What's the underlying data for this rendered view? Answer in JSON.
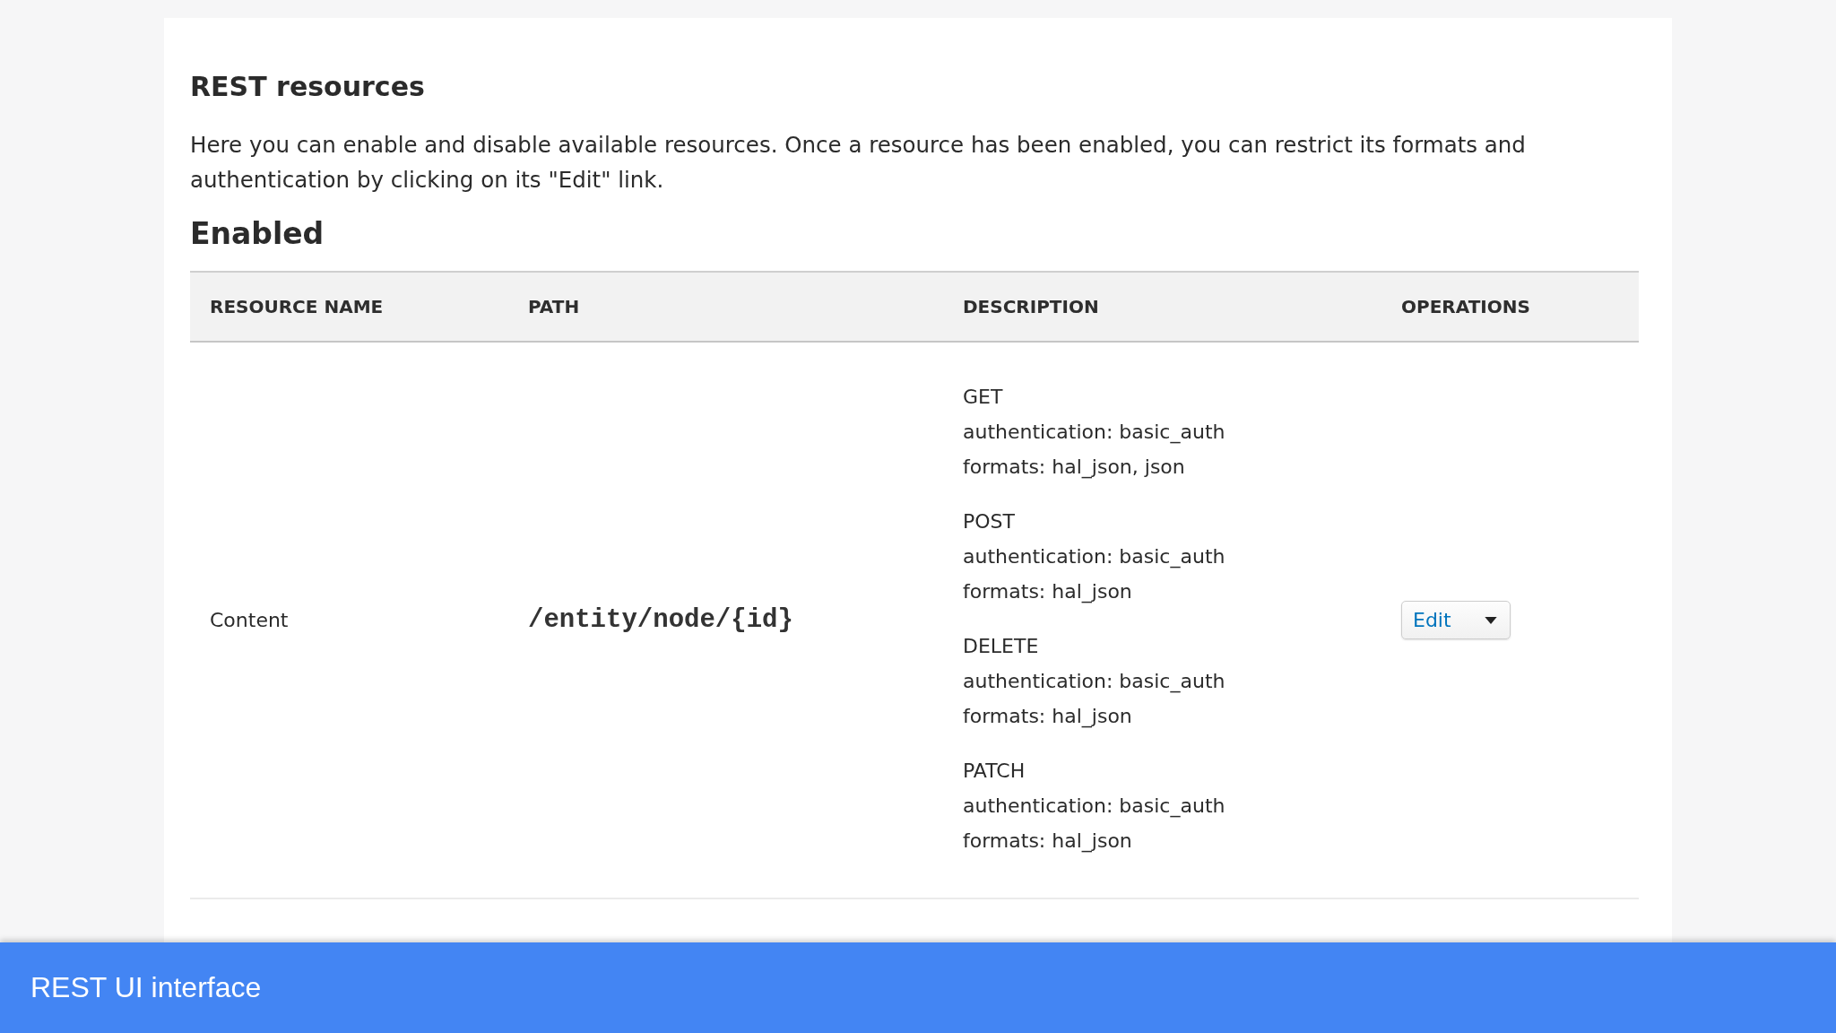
{
  "page": {
    "title": "REST resources",
    "description": "Here you can enable and disable available resources. Once a resource has been enabled, you can restrict its formats and authentication by clicking on its \"Edit\" link.",
    "section_heading": "Enabled"
  },
  "table": {
    "columns": [
      "RESOURCE NAME",
      "PATH",
      "DESCRIPTION",
      "OPERATIONS"
    ],
    "rows": [
      {
        "resource_name": "Content",
        "path": "/entity/node/{id}",
        "methods": [
          {
            "method": "GET",
            "authentication": "authentication: basic_auth",
            "formats": "formats: hal_json, json"
          },
          {
            "method": "POST",
            "authentication": "authentication: basic_auth",
            "formats": "formats: hal_json"
          },
          {
            "method": "DELETE",
            "authentication": "authentication: basic_auth",
            "formats": "formats: hal_json"
          },
          {
            "method": "PATCH",
            "authentication": "authentication: basic_auth",
            "formats": "formats: hal_json"
          }
        ],
        "operations": {
          "label": "Edit"
        }
      }
    ]
  },
  "caption_bar": {
    "text": "REST UI interface"
  }
}
